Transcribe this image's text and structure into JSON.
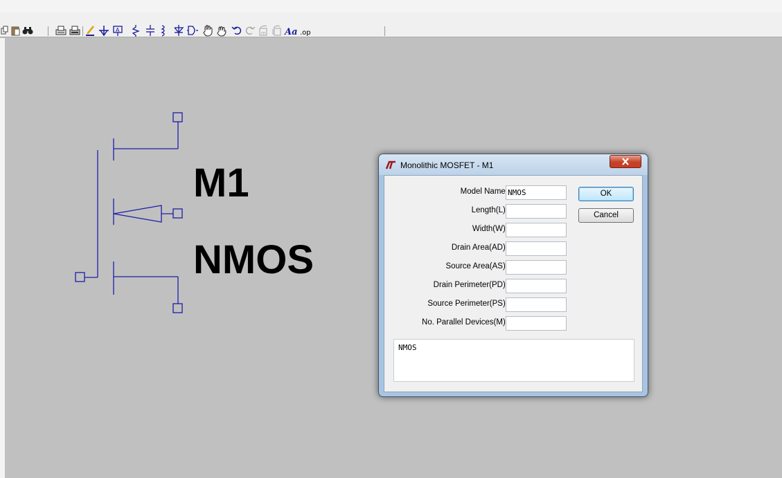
{
  "symbol": {
    "instance_name": "M1",
    "model_value": "NMOS",
    "wire_color": "#1c1caa"
  },
  "toolbar": {
    "icons": [
      "copy-icon",
      "paste-icon",
      "find-icon",
      "print-setup-icon",
      "print-icon",
      "draw-wire-icon",
      "ground-icon",
      "label-net-icon",
      "resistor-icon",
      "capacitor-icon",
      "inductor-icon",
      "diode-icon",
      "component-icon",
      "move-icon",
      "drag-icon",
      "undo-icon",
      "redo-icon",
      "rotate-icon",
      "mirror-icon",
      "text-icon",
      "spice-directive-icon"
    ],
    "text_tool_label": "Aa",
    "spice_directive_label": ".op"
  },
  "dialog": {
    "title": "Monolithic MOSFET - M1",
    "close_glyph": "x",
    "fields": [
      {
        "label": "Model Name:",
        "value": "NMOS"
      },
      {
        "label": "Length(L):",
        "value": ""
      },
      {
        "label": "Width(W):",
        "value": ""
      },
      {
        "label": "Drain Area(AD):",
        "value": ""
      },
      {
        "label": "Source Area(AS):",
        "value": ""
      },
      {
        "label": "Drain Perimeter(PD):",
        "value": ""
      },
      {
        "label": "Source Perimeter(PS):",
        "value": ""
      },
      {
        "label": "No. Parallel Devices(M):",
        "value": ""
      }
    ],
    "ok_label": "OK",
    "cancel_label": "Cancel",
    "model_text": "NMOS"
  }
}
